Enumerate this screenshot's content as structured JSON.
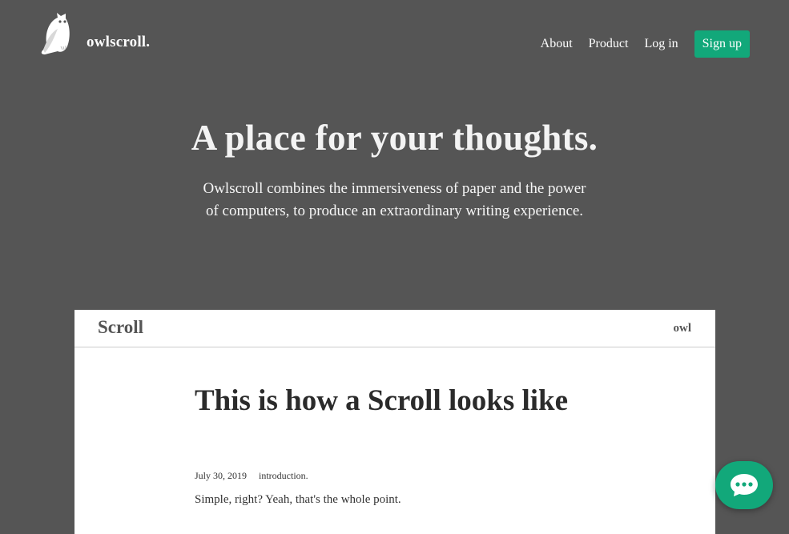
{
  "header": {
    "brand": "owlscroll.",
    "nav": {
      "about": "About",
      "product": "Product",
      "login": "Log in",
      "signup": "Sign up"
    }
  },
  "hero": {
    "title": "A place for your thoughts.",
    "subtitle_line1": "Owlscroll combines the immersiveness of paper and the power",
    "subtitle_line2": "of computers, to produce an extraordinary writing experience."
  },
  "preview": {
    "app_title": "Scroll",
    "user": "owl",
    "post": {
      "title": "This is how a Scroll looks like",
      "date": "July 30, 2019",
      "tag": "introduction.",
      "body": "Simple, right? Yeah, that's the whole point."
    }
  },
  "icons": {
    "logo": "owl-logo-icon",
    "chat": "chat-bubble-icon"
  },
  "colors": {
    "background": "#555555",
    "accent": "#12a87a",
    "card": "#ffffff"
  }
}
